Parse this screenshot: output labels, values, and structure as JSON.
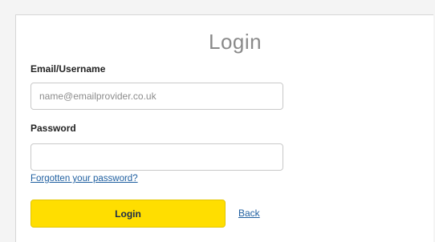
{
  "login_form": {
    "title": "Login",
    "email_label": "Email/Username",
    "email_placeholder": "name@emailprovider.co.uk",
    "email_value": "",
    "password_label": "Password",
    "password_value": "",
    "forgot_link": "Forgotten your password?",
    "login_button": "Login",
    "back_link": "Back"
  },
  "colors": {
    "button_bg": "#ffde00",
    "link": "#1f5fa0",
    "title": "#8a8a8a"
  }
}
